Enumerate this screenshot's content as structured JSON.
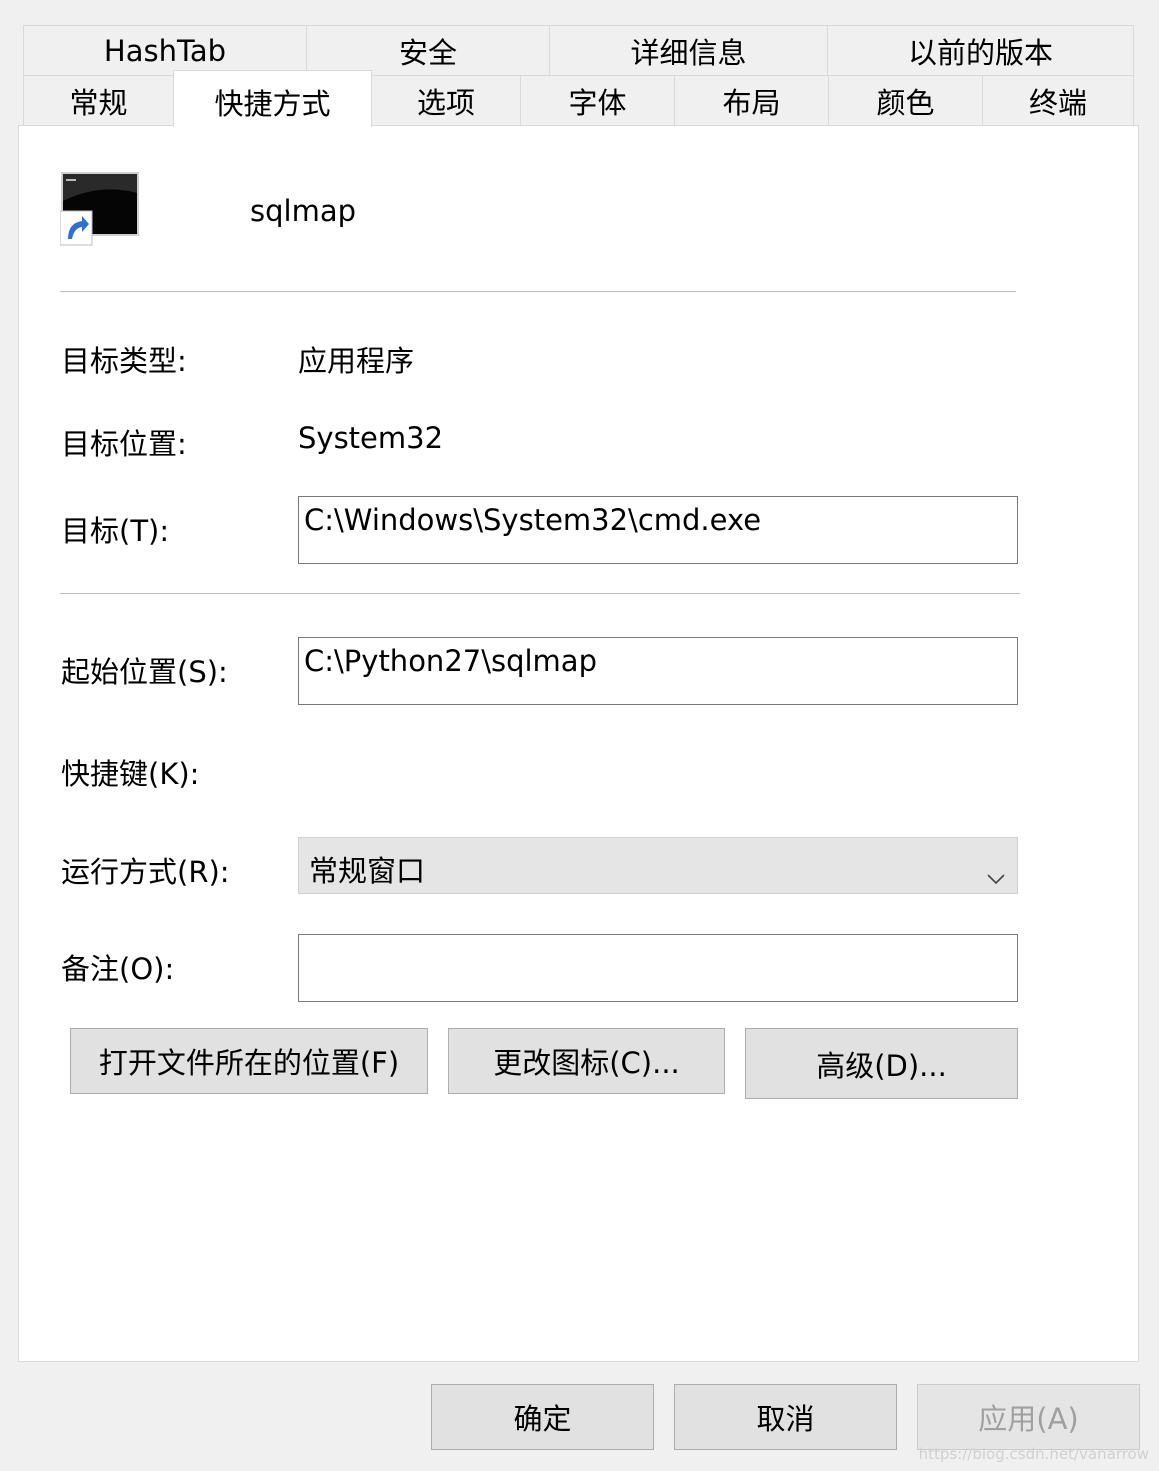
{
  "tabs_row1": [
    "HashTab",
    "安全",
    "详细信息",
    "以前的版本"
  ],
  "tabs_row2": [
    "常规",
    "快捷方式",
    "选项",
    "字体",
    "布局",
    "颜色",
    "终端"
  ],
  "active_tab": "快捷方式",
  "shortcut": {
    "name": "sqlmap",
    "icon": "cmd-shortcut-icon"
  },
  "properties": {
    "target_type_label": "目标类型:",
    "target_type_value": "应用程序",
    "target_location_label": "目标位置:",
    "target_location_value": "System32",
    "target_label": "目标(T):",
    "target_value": "C:\\Windows\\System32\\cmd.exe",
    "start_in_label": "起始位置(S):",
    "start_in_value": "C:\\Python27\\sqlmap",
    "hotkey_label": "快捷键(K):",
    "run_label": "运行方式(R):",
    "run_value": "常规窗口",
    "comment_label": "备注(O):",
    "comment_value": ""
  },
  "buttons": {
    "open_location": "打开文件所在的位置(F)",
    "change_icon": "更改图标(C)...",
    "advanced": "高级(D)..."
  },
  "footer": {
    "ok": "确定",
    "cancel": "取消",
    "apply": "应用(A)"
  },
  "watermark": "https://blog.csdn.net/vanarrow"
}
